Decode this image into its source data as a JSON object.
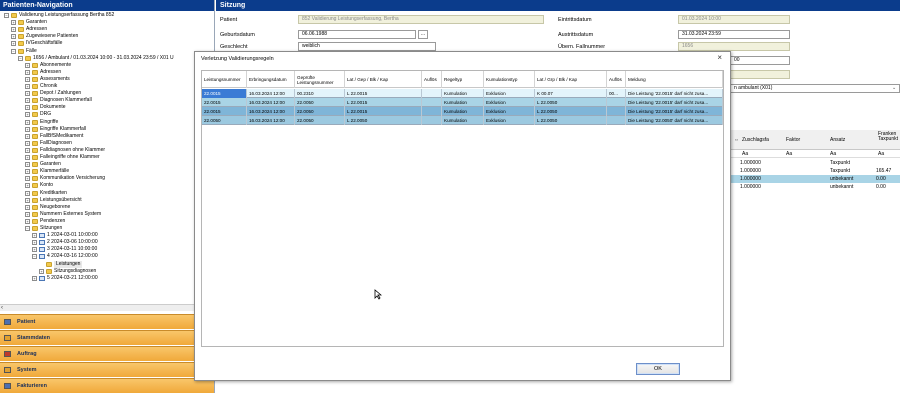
{
  "nav": {
    "title": "Patienten-Navigation",
    "tree": [
      {
        "indent": 0,
        "exp": "−",
        "icon": "folder",
        "label": "Validierung Leistungserfassung Bertha 852"
      },
      {
        "indent": 1,
        "exp": "+",
        "icon": "folder",
        "label": "Garanten"
      },
      {
        "indent": 1,
        "exp": "+",
        "icon": "folder",
        "label": "Adressen"
      },
      {
        "indent": 1,
        "exp": "+",
        "icon": "folder",
        "label": "Zugewiesene Patienten"
      },
      {
        "indent": 1,
        "exp": "+",
        "icon": "folder",
        "label": "IVGeschäftsfälle"
      },
      {
        "indent": 1,
        "exp": "−",
        "icon": "folder",
        "label": "Fälle"
      },
      {
        "indent": 2,
        "exp": "−",
        "icon": "folder",
        "label": "1656 / Ambulant / 01.03.2024 10:00 - 31.03.2024 23:59 / X01 U"
      },
      {
        "indent": 3,
        "exp": "+",
        "icon": "folder",
        "label": "Abonnemente"
      },
      {
        "indent": 3,
        "exp": "+",
        "icon": "folder",
        "label": "Adressen"
      },
      {
        "indent": 3,
        "exp": "+",
        "icon": "folder",
        "label": "Assessments"
      },
      {
        "indent": 3,
        "exp": "+",
        "icon": "folder",
        "label": "Chronik"
      },
      {
        "indent": 3,
        "exp": "+",
        "icon": "folder",
        "label": "Depot / Zahlungen"
      },
      {
        "indent": 3,
        "exp": "+",
        "icon": "folder",
        "label": "Diagnosen Klammerfall"
      },
      {
        "indent": 3,
        "exp": "+",
        "icon": "folder",
        "label": "Dokumente"
      },
      {
        "indent": 3,
        "exp": "+",
        "icon": "folder",
        "label": "DRG"
      },
      {
        "indent": 3,
        "exp": "+",
        "icon": "folder",
        "label": "Eingriffe"
      },
      {
        "indent": 3,
        "exp": "+",
        "icon": "folder",
        "label": "Eingriffe Klammerfall"
      },
      {
        "indent": 3,
        "exp": "+",
        "icon": "folder",
        "label": "FallBfSMedikament"
      },
      {
        "indent": 3,
        "exp": "+",
        "icon": "folder",
        "label": "FallDiagnosen"
      },
      {
        "indent": 3,
        "exp": "+",
        "icon": "folder",
        "label": "Falldiagnosen ohne Klammer"
      },
      {
        "indent": 3,
        "exp": "+",
        "icon": "folder",
        "label": "Falleingriffe ohne Klammer"
      },
      {
        "indent": 3,
        "exp": "+",
        "icon": "folder",
        "label": "Garanten"
      },
      {
        "indent": 3,
        "exp": "+",
        "icon": "folder",
        "label": "Klammerfälle"
      },
      {
        "indent": 3,
        "exp": "+",
        "icon": "folder",
        "label": "Kommunikation Versicherung"
      },
      {
        "indent": 3,
        "exp": "+",
        "icon": "folder",
        "label": "Konto"
      },
      {
        "indent": 3,
        "exp": "+",
        "icon": "folder",
        "label": "Kreditkarten"
      },
      {
        "indent": 3,
        "exp": "+",
        "icon": "folder",
        "label": "Leistungsübersicht"
      },
      {
        "indent": 3,
        "exp": "+",
        "icon": "folder",
        "label": "Neugeborene"
      },
      {
        "indent": 3,
        "exp": "+",
        "icon": "folder",
        "label": "Nummern Externes System"
      },
      {
        "indent": 3,
        "exp": "+",
        "icon": "folder",
        "label": "Pendenzen"
      },
      {
        "indent": 3,
        "exp": "−",
        "icon": "folder",
        "label": "Sitzungen"
      },
      {
        "indent": 4,
        "exp": "+",
        "icon": "cal",
        "label": "1 2024-03-01 10:00:00"
      },
      {
        "indent": 4,
        "exp": "+",
        "icon": "cal",
        "label": "2 2024-03-06 10:00:00"
      },
      {
        "indent": 4,
        "exp": "+",
        "icon": "cal",
        "label": "3 2024-03-11 10:00:00"
      },
      {
        "indent": 4,
        "exp": "−",
        "icon": "cal",
        "label": "4 2024-03-16 12:00:00"
      },
      {
        "indent": 5,
        "exp": "",
        "icon": "folder",
        "label": "Leistungen"
      },
      {
        "indent": 5,
        "exp": "+",
        "icon": "folder",
        "label": "Sitzungsdiagnosen"
      },
      {
        "indent": 4,
        "exp": "+",
        "icon": "cal",
        "label": "5 2024-03-21 12:00:00"
      }
    ],
    "buttons": [
      {
        "label": "Patient",
        "icon": "patient-icon"
      },
      {
        "label": "Stammdaten",
        "icon": "folder-icon"
      },
      {
        "label": "Auftrag",
        "icon": "order-icon"
      },
      {
        "label": "System",
        "icon": "system-icon"
      },
      {
        "label": "Fakturieren",
        "icon": "invoice-icon"
      }
    ]
  },
  "sitzung": {
    "title": "Sitzung",
    "patient_label": "Patient",
    "patient_value": "852 Validierung Leistungserfassung, Bertha",
    "geburtsdatum_label": "Geburtsdatum",
    "geburtsdatum_value": "06.06.1988",
    "geschlecht_label": "Geschlecht",
    "geschlecht_value": "weiblich",
    "eintritt_label": "Eintrittsdatum",
    "eintritt_value": "01.03.2024 10:00",
    "austritt_label": "Austrittsdatum",
    "austritt_value": "31.03.2024 23:59",
    "fallnummer_label": "Übern. Fallnummer",
    "fallnummer_value": "1656",
    "partial_value": "00",
    "select_value": "n ambulant  (X01)",
    "right_headers": [
      "Zuschlagsfa",
      "Faktor",
      "Ansatz",
      "Franken Taxpunkt"
    ],
    "right_filters": [
      "Aa",
      "Aa",
      "Aa",
      "Aa"
    ],
    "right_rows": [
      {
        "zuschlag": "1.000000",
        "ansatz": "Taxpunkt",
        "franken": "",
        "highlight": false
      },
      {
        "zuschlag": "1.000000",
        "ansatz": "Taxpunkt",
        "franken": "165.47",
        "highlight": false
      },
      {
        "zuschlag": "1.000000",
        "ansatz": "unbekannt",
        "franken": "0.00",
        "highlight": true
      },
      {
        "zuschlag": "1.000000",
        "ansatz": "unbekannt",
        "franken": "0.00",
        "highlight": false
      }
    ]
  },
  "dialog": {
    "title": "Verletzung Validierungsregeln",
    "close": "×",
    "columns": [
      "Leistungsnummer",
      "Erbringungsdatum",
      "Geprüfte Leistungsnummer",
      "Lat / Gep / Blk / Kap",
      "Auflös",
      "Regeltyp",
      "Kumulationstyp",
      "Lat / Grp / Blk / Kap",
      "Auflös",
      "Meldung"
    ],
    "rows": [
      {
        "cells": [
          "22.0015",
          "16.03.2024 12:00",
          "00.2310",
          "L 22.0015",
          "",
          "Kumulation",
          "Exklusion",
          "K 00.07",
          "00...",
          "Die Leistung '22.0015' darf nicht zusa..."
        ],
        "style": "light"
      },
      {
        "cells": [
          "22.0015",
          "16.03.2024 12:00",
          "22.0050",
          "L 22.0015",
          "",
          "Kumulation",
          "Exklusion",
          "L 22.0050",
          "",
          "Die Leistung '22.0015' darf nicht zusa..."
        ],
        "style": "mid"
      },
      {
        "cells": [
          "22.0015",
          "16.03.2024 12:00",
          "22.0050",
          "L 22.0015",
          "",
          "Kumulation",
          "Exklusion",
          "L 22.0050",
          "",
          "Die Leistung '22.0015' darf nicht zusa..."
        ],
        "style": "dark"
      },
      {
        "cells": [
          "22.0050",
          "16.03.2024 12:00",
          "22.0050",
          "L 22.0050",
          "",
          "Kumulation",
          "Exklusion",
          "L 22.0050",
          "",
          "Die Leistung '22.0050' darf nicht zusa..."
        ],
        "style": "mid2"
      }
    ],
    "ok_label": "OK"
  },
  "colors": {
    "header_blue": "#0b3c8c",
    "row_light": "#e3f4fb",
    "row_mid": "#a9d4e6",
    "row_dark": "#7fb5d8",
    "nav_button": "#f0a93a"
  }
}
